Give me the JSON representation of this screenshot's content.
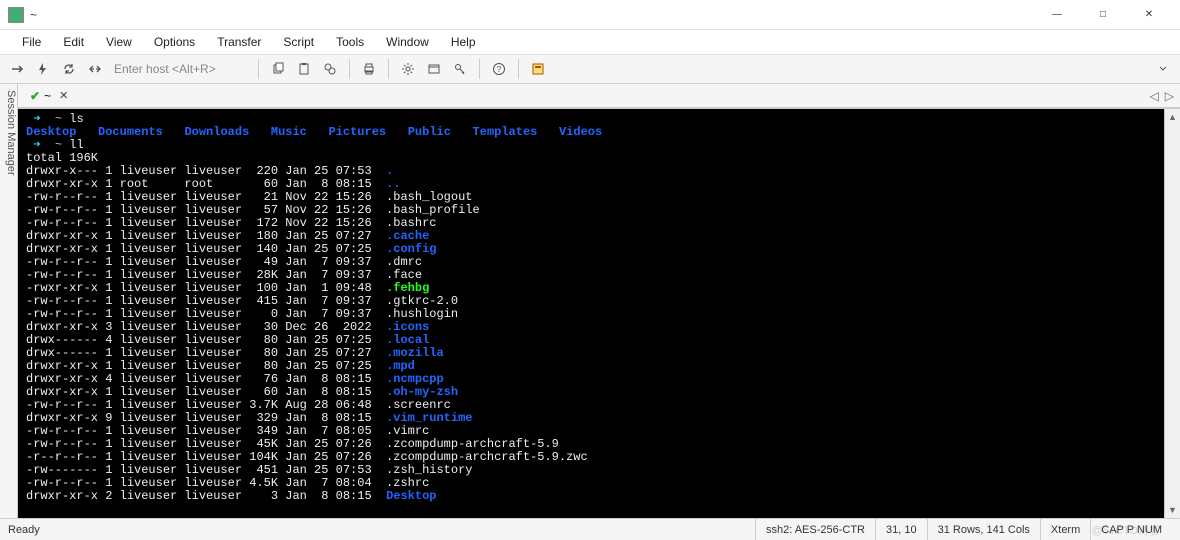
{
  "window": {
    "title": "~",
    "min": "—",
    "max": "□",
    "close": "✕"
  },
  "menu": [
    "File",
    "Edit",
    "View",
    "Options",
    "Transfer",
    "Script",
    "Tools",
    "Window",
    "Help"
  ],
  "toolbar": {
    "host_placeholder": "Enter host <Alt+R>"
  },
  "sidebar": {
    "label": "Session Manager"
  },
  "tab": {
    "label": "~",
    "close": "✕"
  },
  "terminal": {
    "prompt1": " ~ ",
    "cmd1": "ls",
    "ls_output": [
      "Desktop",
      "Documents",
      "Downloads",
      "Music",
      "Pictures",
      "Public",
      "Templates",
      "Videos"
    ],
    "prompt2": " ~ ",
    "cmd2": "ll",
    "total": "total 196K",
    "rows": [
      {
        "perm": "drwxr-x---",
        "links": "1",
        "owner": "liveuser",
        "group": "liveuser",
        "size": "220",
        "date": "Jan 25 07:53",
        "name": ".",
        "color": "blue"
      },
      {
        "perm": "drwxr-xr-x",
        "links": "1",
        "owner": "root    ",
        "group": "root    ",
        "size": "60",
        "date": "Jan  8 08:15",
        "name": "..",
        "color": "blue"
      },
      {
        "perm": "-rw-r--r--",
        "links": "1",
        "owner": "liveuser",
        "group": "liveuser",
        "size": "21",
        "date": "Nov 22 15:26",
        "name": ".bash_logout",
        "color": ""
      },
      {
        "perm": "-rw-r--r--",
        "links": "1",
        "owner": "liveuser",
        "group": "liveuser",
        "size": "57",
        "date": "Nov 22 15:26",
        "name": ".bash_profile",
        "color": ""
      },
      {
        "perm": "-rw-r--r--",
        "links": "1",
        "owner": "liveuser",
        "group": "liveuser",
        "size": "172",
        "date": "Nov 22 15:26",
        "name": ".bashrc",
        "color": ""
      },
      {
        "perm": "drwxr-xr-x",
        "links": "1",
        "owner": "liveuser",
        "group": "liveuser",
        "size": "180",
        "date": "Jan 25 07:27",
        "name": ".cache",
        "color": "blue"
      },
      {
        "perm": "drwxr-xr-x",
        "links": "1",
        "owner": "liveuser",
        "group": "liveuser",
        "size": "140",
        "date": "Jan 25 07:25",
        "name": ".config",
        "color": "blue"
      },
      {
        "perm": "-rw-r--r--",
        "links": "1",
        "owner": "liveuser",
        "group": "liveuser",
        "size": "49",
        "date": "Jan  7 09:37",
        "name": ".dmrc",
        "color": ""
      },
      {
        "perm": "-rw-r--r--",
        "links": "1",
        "owner": "liveuser",
        "group": "liveuser",
        "size": "28K",
        "date": "Jan  7 09:37",
        "name": ".face",
        "color": ""
      },
      {
        "perm": "-rwxr-xr-x",
        "links": "1",
        "owner": "liveuser",
        "group": "liveuser",
        "size": "100",
        "date": "Jan  1 09:48",
        "name": ".fehbg",
        "color": "green"
      },
      {
        "perm": "-rw-r--r--",
        "links": "1",
        "owner": "liveuser",
        "group": "liveuser",
        "size": "415",
        "date": "Jan  7 09:37",
        "name": ".gtkrc-2.0",
        "color": ""
      },
      {
        "perm": "-rw-r--r--",
        "links": "1",
        "owner": "liveuser",
        "group": "liveuser",
        "size": "0",
        "date": "Jan  7 09:37",
        "name": ".hushlogin",
        "color": ""
      },
      {
        "perm": "drwxr-xr-x",
        "links": "3",
        "owner": "liveuser",
        "group": "liveuser",
        "size": "30",
        "date": "Dec 26  2022",
        "name": ".icons",
        "color": "blue"
      },
      {
        "perm": "drwx------",
        "links": "4",
        "owner": "liveuser",
        "group": "liveuser",
        "size": "80",
        "date": "Jan 25 07:25",
        "name": ".local",
        "color": "blue"
      },
      {
        "perm": "drwx------",
        "links": "1",
        "owner": "liveuser",
        "group": "liveuser",
        "size": "80",
        "date": "Jan 25 07:27",
        "name": ".mozilla",
        "color": "blue"
      },
      {
        "perm": "drwxr-xr-x",
        "links": "1",
        "owner": "liveuser",
        "group": "liveuser",
        "size": "80",
        "date": "Jan 25 07:25",
        "name": ".mpd",
        "color": "blue"
      },
      {
        "perm": "drwxr-xr-x",
        "links": "4",
        "owner": "liveuser",
        "group": "liveuser",
        "size": "76",
        "date": "Jan  8 08:15",
        "name": ".ncmpcpp",
        "color": "blue"
      },
      {
        "perm": "drwxr-xr-x",
        "links": "1",
        "owner": "liveuser",
        "group": "liveuser",
        "size": "60",
        "date": "Jan  8 08:15",
        "name": ".oh-my-zsh",
        "color": "blue"
      },
      {
        "perm": "-rw-r--r--",
        "links": "1",
        "owner": "liveuser",
        "group": "liveuser",
        "size": "3.7K",
        "date": "Aug 28 06:48",
        "name": ".screenrc",
        "color": ""
      },
      {
        "perm": "drwxr-xr-x",
        "links": "9",
        "owner": "liveuser",
        "group": "liveuser",
        "size": "329",
        "date": "Jan  8 08:15",
        "name": ".vim_runtime",
        "color": "blue"
      },
      {
        "perm": "-rw-r--r--",
        "links": "1",
        "owner": "liveuser",
        "group": "liveuser",
        "size": "349",
        "date": "Jan  7 08:05",
        "name": ".vimrc",
        "color": ""
      },
      {
        "perm": "-rw-r--r--",
        "links": "1",
        "owner": "liveuser",
        "group": "liveuser",
        "size": "45K",
        "date": "Jan 25 07:26",
        "name": ".zcompdump-archcraft-5.9",
        "color": ""
      },
      {
        "perm": "-r--r--r--",
        "links": "1",
        "owner": "liveuser",
        "group": "liveuser",
        "size": "104K",
        "date": "Jan 25 07:26",
        "name": ".zcompdump-archcraft-5.9.zwc",
        "color": ""
      },
      {
        "perm": "-rw-------",
        "links": "1",
        "owner": "liveuser",
        "group": "liveuser",
        "size": "451",
        "date": "Jan 25 07:53",
        "name": ".zsh_history",
        "color": ""
      },
      {
        "perm": "-rw-r--r--",
        "links": "1",
        "owner": "liveuser",
        "group": "liveuser",
        "size": "4.5K",
        "date": "Jan  7 08:04",
        "name": ".zshrc",
        "color": ""
      },
      {
        "perm": "drwxr-xr-x",
        "links": "2",
        "owner": "liveuser",
        "group": "liveuser",
        "size": "3",
        "date": "Jan  8 08:15",
        "name": "Desktop",
        "color": "blue"
      }
    ]
  },
  "status": {
    "ready": "Ready",
    "cipher": "ssh2: AES-256-CTR",
    "cursor": "31,  10",
    "size": "31 Rows, 141 Cols",
    "emulation": "Xterm",
    "caps": "CAP P NUM"
  }
}
